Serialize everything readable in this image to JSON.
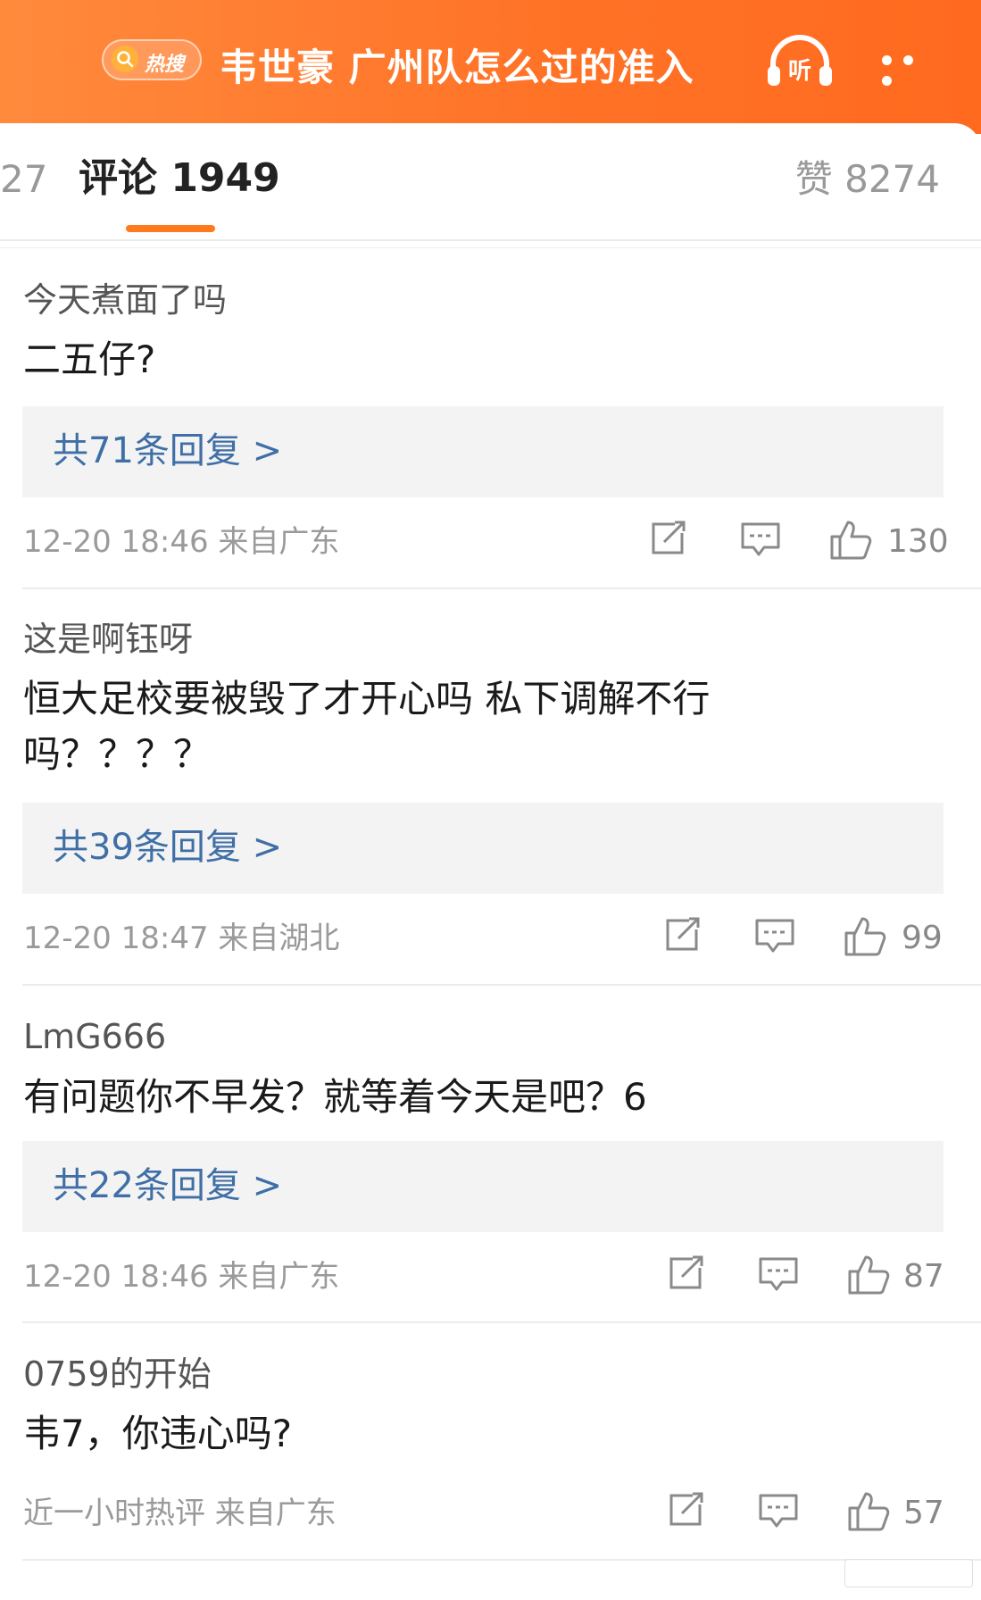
{
  "colors": {
    "brand_orange": "#ff7327",
    "link_blue": "#3f6fa6",
    "meta_gray": "#9a9a9a",
    "reply_bg": "#f3f3f3"
  },
  "header": {
    "hot_badge": "热搜",
    "title": "韦世豪 广州队怎么过的准入",
    "listen_label": "听"
  },
  "tabs": {
    "prev_partial": "27",
    "comments_label": "评论 1949",
    "likes_label": "赞 8274"
  },
  "comments": [
    {
      "user": "今天煮面了吗",
      "text": "二五仔?",
      "replies": "共71条回复 >",
      "meta": "12-20 18:46  来自广东",
      "likes": "130"
    },
    {
      "user": "这是啊钰呀",
      "text": "恒大足校要被毁了才开心吗 私下调解不行吗？？？？",
      "replies": "共39条回复 >",
      "meta": "12-20 18:47  来自湖北",
      "likes": "99"
    },
    {
      "user": "LmG666",
      "text": "有问题你不早发？就等着今天是吧？6",
      "replies": "共22条回复 >",
      "meta": "12-20 18:46  来自广东",
      "likes": "87"
    },
    {
      "user": "0759的开始",
      "text": "韦7，你违心吗?",
      "meta": "近一小时热评  来自广东",
      "likes": "57"
    }
  ],
  "icons": {
    "search": "search-icon",
    "listen": "headphones-icon",
    "more": "more-icon",
    "repost": "repost-icon",
    "reply": "comment-icon",
    "like": "thumbs-up-icon"
  }
}
